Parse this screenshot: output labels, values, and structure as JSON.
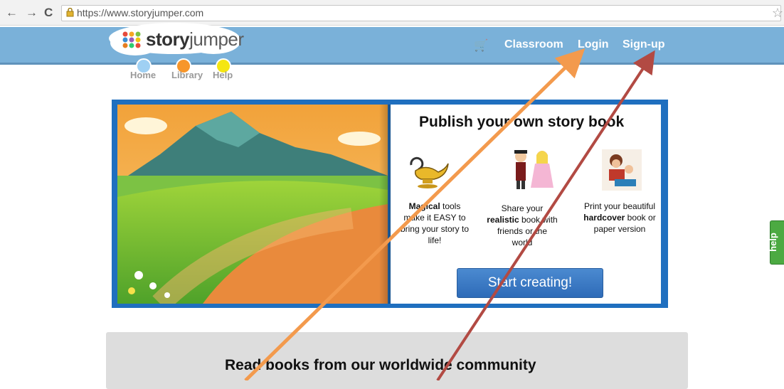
{
  "browser": {
    "back": "←",
    "forward": "→",
    "reload": "C",
    "url": "https://www.storyjumper.com",
    "star": "☆"
  },
  "logo": {
    "part1": "story",
    "part2": "jumper"
  },
  "topnav": {
    "cart": "🛒",
    "classroom": "Classroom",
    "login": "Login",
    "signup": "Sign-up"
  },
  "subnav": [
    {
      "label": "Home",
      "color": "#9fd0f3"
    },
    {
      "label": "Library",
      "color": "#f7962a"
    },
    {
      "label": "Help",
      "color": "#f5e612"
    }
  ],
  "hero": {
    "title": "Publish your own story book",
    "features": [
      {
        "bold": "Magical",
        "text": " tools make it EASY to bring your story to life!"
      },
      {
        "pre": "Share your ",
        "bold": "realistic",
        "text": " book with friends or the world"
      },
      {
        "pre": "Print your beautiful ",
        "bold": "hardcover",
        "text": " book or paper version"
      }
    ],
    "button": "Start creating!"
  },
  "community": {
    "title": "Read books from our worldwide community"
  },
  "help_tab": "help",
  "colors": {
    "header": "#7ab1d9",
    "frame": "#1f6fbf",
    "arrow_orange": "#f39a4d",
    "arrow_red": "#b24a43"
  }
}
